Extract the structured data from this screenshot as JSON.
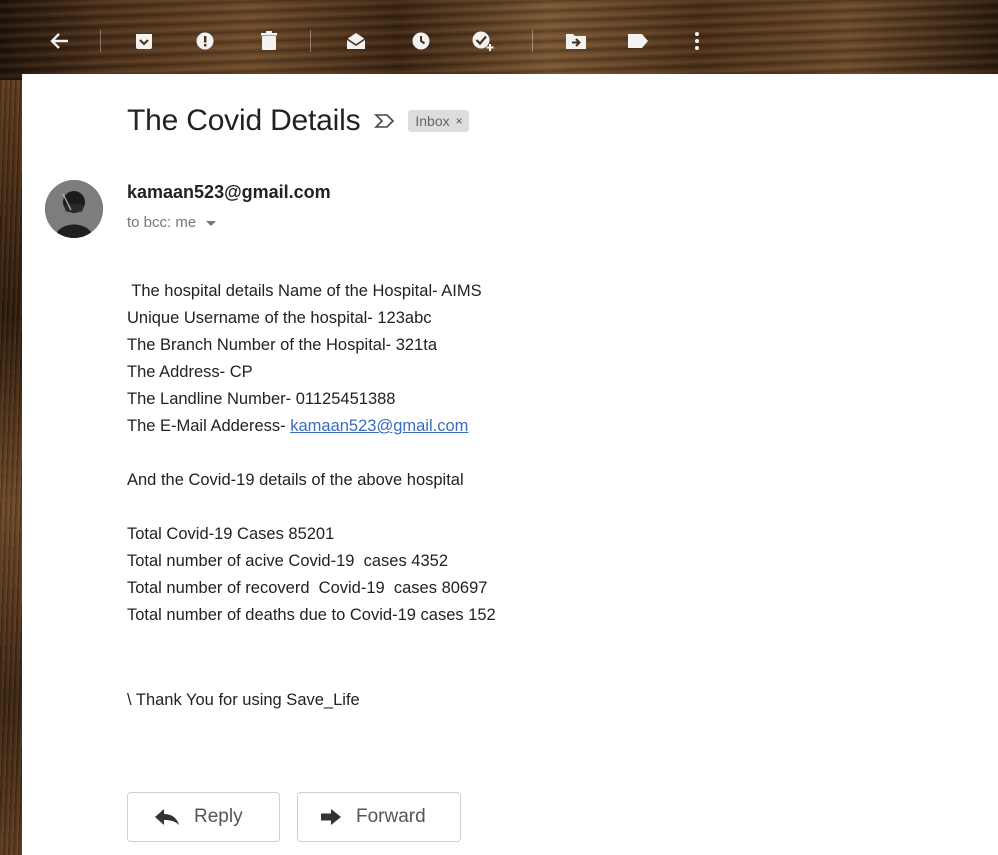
{
  "toolbar": {
    "icons": [
      "back-arrow-icon",
      "archive-icon",
      "report-spam-icon",
      "delete-icon",
      "mark-unread-icon",
      "snooze-icon",
      "add-to-tasks-icon",
      "move-to-icon",
      "label-icon",
      "more-options-icon"
    ]
  },
  "message": {
    "subject": "The Covid Details",
    "label": "Inbox",
    "label_close": "×",
    "sender": "kamaan523@gmail.com",
    "recipients": "to bcc: me",
    "body": {
      "line1": " The hospital details Name of the Hospital- AIMS",
      "line2": "Unique Username of the hospital- 123abc",
      "line3": "The Branch Number of the Hospital- 321ta",
      "line4": "The Address- CP",
      "line5": "The Landline Number- 01125451388",
      "line6_prefix": "The E-Mail Adderess- ",
      "line6_link": "kamaan523@gmail.com",
      "line7": "And the Covid-19 details of the above hospital",
      "line8": "Total Covid-19 Cases 85201",
      "line9": "Total number of acive Covid-19  cases 4352",
      "line10": "Total number of recoverd  Covid-19  cases 80697",
      "line11": "Total number of deaths due to Covid-19 cases 152",
      "line12": "\\ Thank You for using Save_Life"
    }
  },
  "actions": {
    "reply": "Reply",
    "forward": "Forward"
  }
}
